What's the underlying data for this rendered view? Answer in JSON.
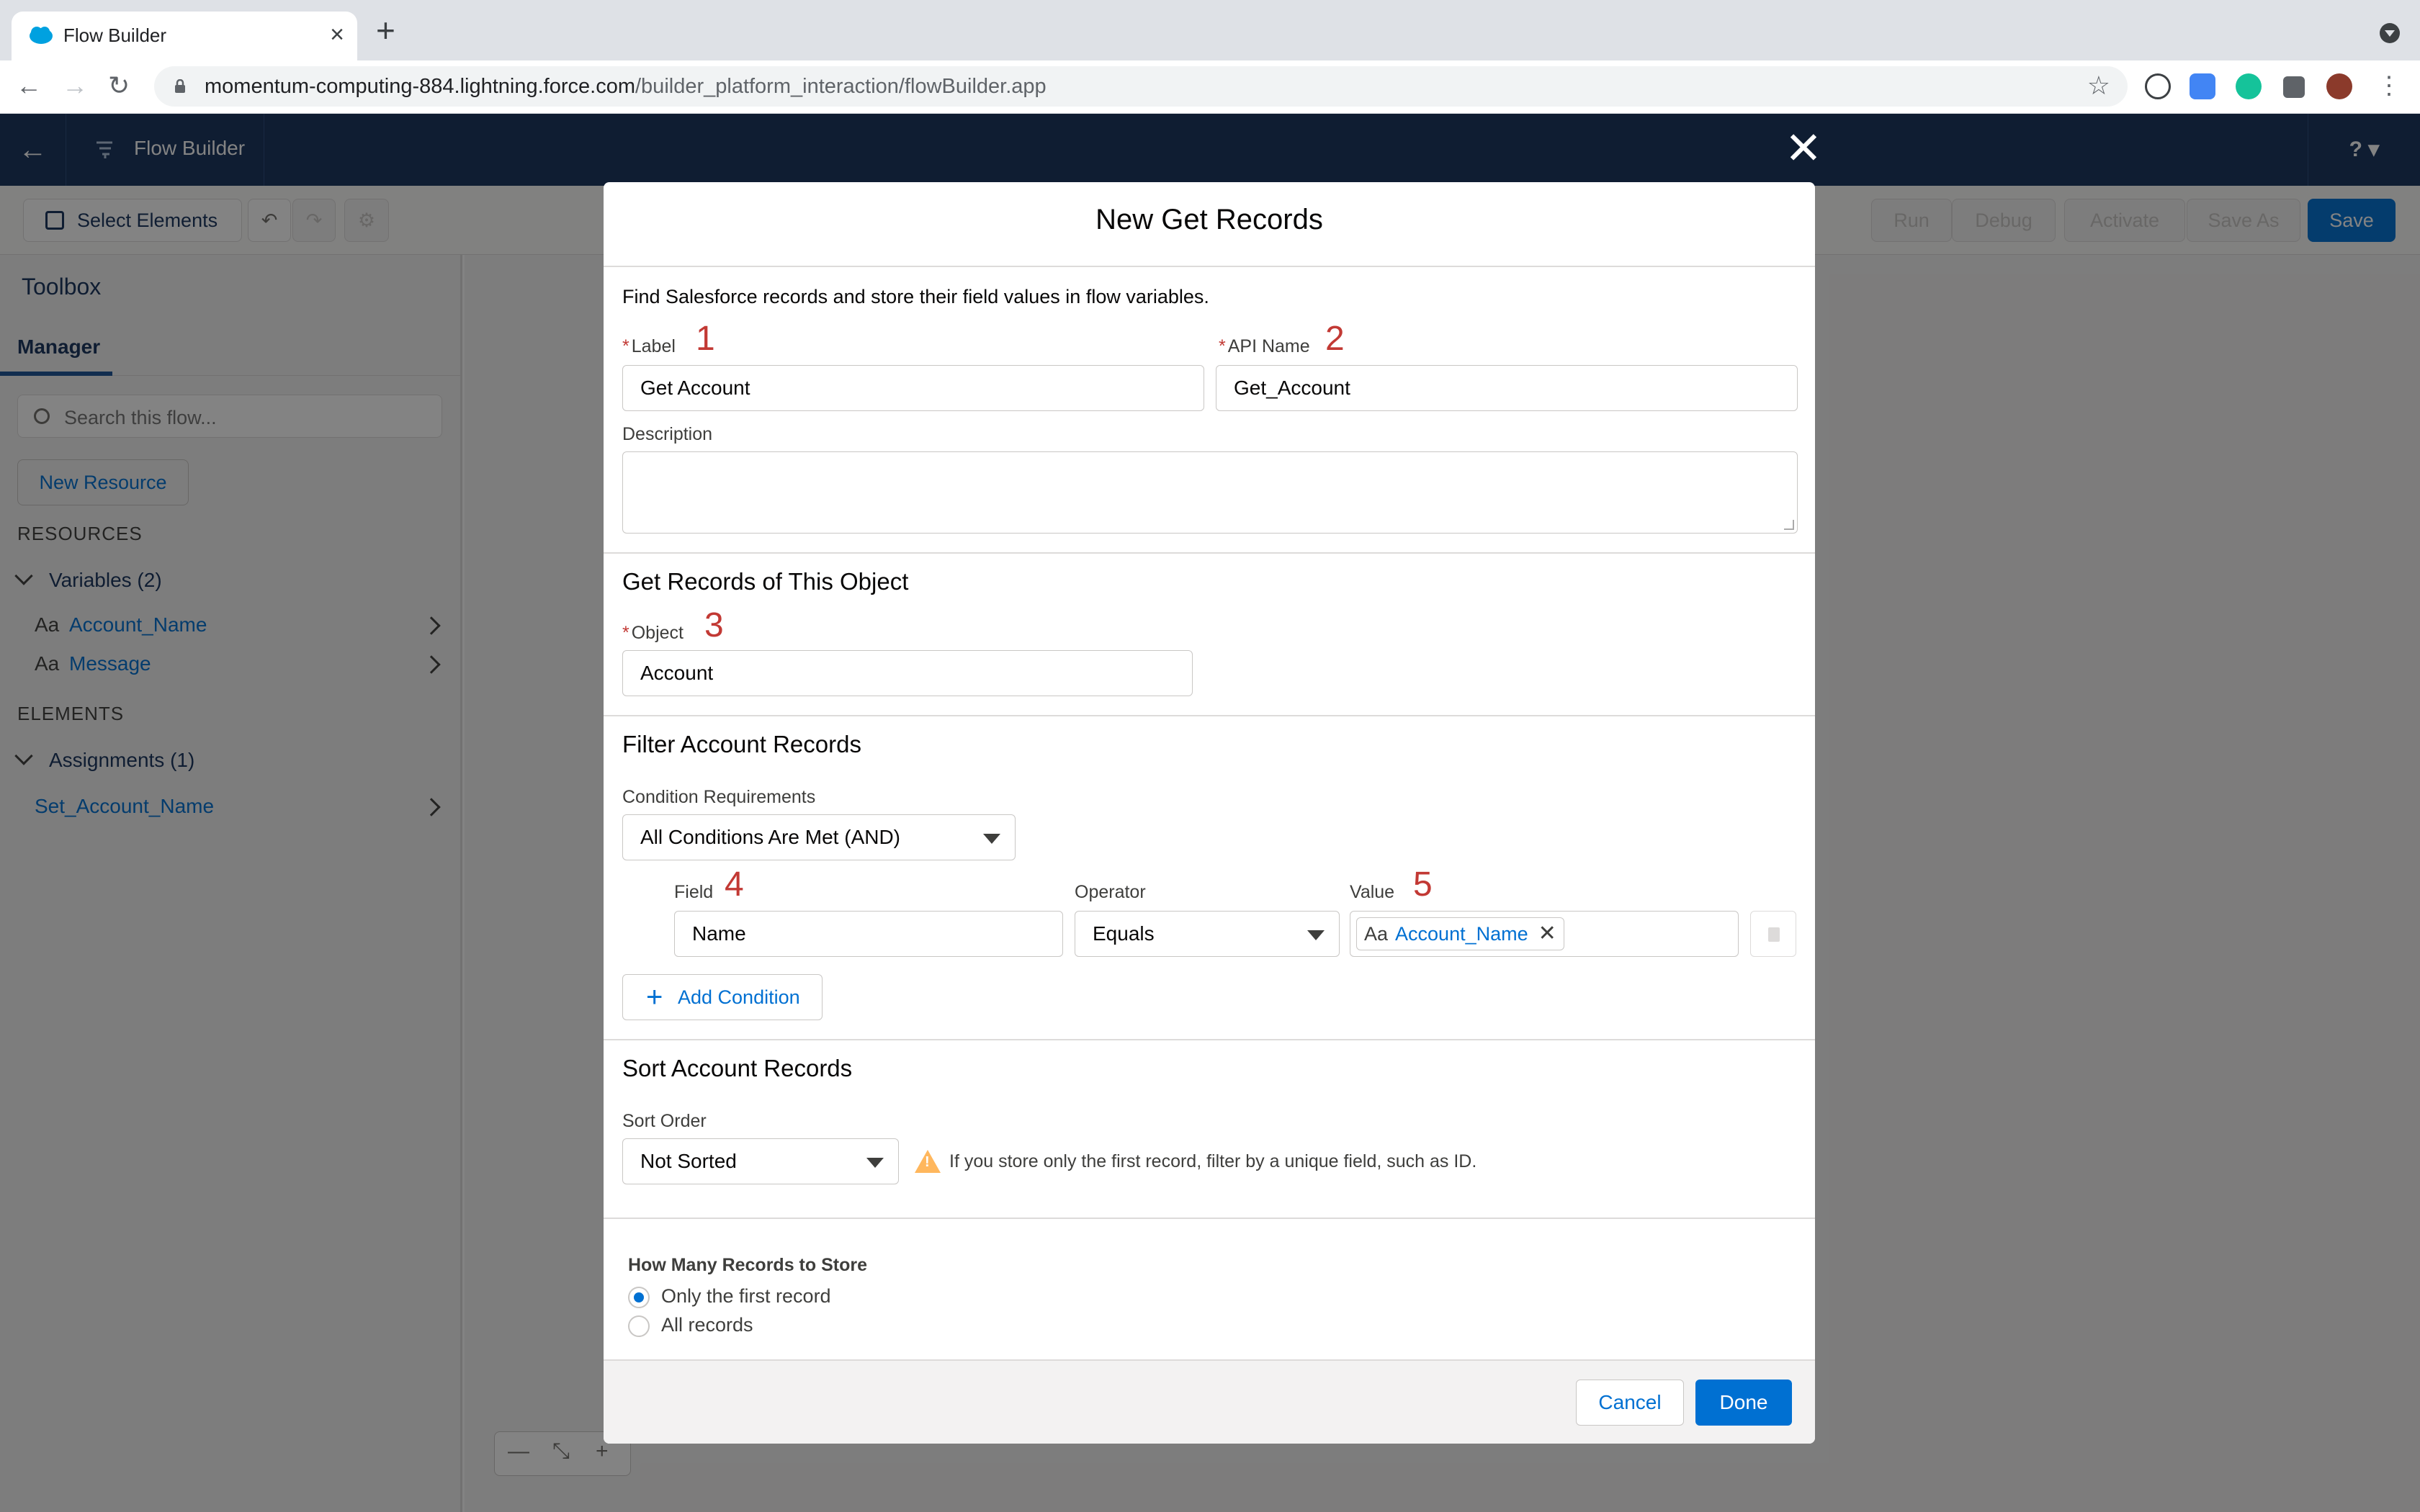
{
  "browser": {
    "tab_title": "Flow Builder",
    "url_host": "momentum-computing-884.lightning.force.com",
    "url_path": "/builder_platform_interaction/flowBuilder.app"
  },
  "app": {
    "title": "Flow Builder",
    "help": "?"
  },
  "toolbar": {
    "select_elements": "Select Elements",
    "run": "Run",
    "debug": "Debug",
    "activate": "Activate",
    "save_as": "Save As",
    "save": "Save"
  },
  "toolbox": {
    "title": "Toolbox",
    "tab_manager": "Manager",
    "search_placeholder": "Search this flow...",
    "new_resource": "New Resource",
    "resources_heading": "RESOURCES",
    "variables_group": "Variables (2)",
    "variables": [
      {
        "type": "Aa",
        "label": "Account_Name"
      },
      {
        "type": "Aa",
        "label": "Message"
      }
    ],
    "elements_heading": "ELEMENTS",
    "assignments_group": "Assignments (1)",
    "assignments": [
      {
        "label": "Set_Account_Name"
      }
    ]
  },
  "modal": {
    "title": "New Get Records",
    "intro": "Find Salesforce records and store their field values in flow variables.",
    "label_field": {
      "label": "Label",
      "value": "Get Account",
      "mark": "1"
    },
    "api_field": {
      "label": "API Name",
      "value": "Get_Account",
      "mark": "2"
    },
    "description_label": "Description",
    "object_section": {
      "title": "Get Records of This Object",
      "label": "Object",
      "value": "Account",
      "mark": "3"
    },
    "filter_section": {
      "title": "Filter Account Records",
      "req_label": "Condition Requirements",
      "req_value": "All Conditions Are Met (AND)",
      "field_label": "Field",
      "field_mark": "4",
      "field_value": "Name",
      "operator_label": "Operator",
      "operator_value": "Equals",
      "value_label": "Value",
      "value_mark": "5",
      "value_pill_type": "Aa",
      "value_pill": "Account_Name",
      "add_condition": "Add Condition"
    },
    "sort_section": {
      "title": "Sort Account Records",
      "label": "Sort Order",
      "value": "Not Sorted",
      "warning": "If you store only the first record, filter by a unique field, such as ID."
    },
    "store_section": {
      "title": "How Many Records to Store",
      "options": [
        {
          "label": "Only the first record",
          "checked": true
        },
        {
          "label": "All records",
          "checked": false
        }
      ]
    },
    "cancel": "Cancel",
    "done": "Done"
  },
  "colors": {
    "header_navy": "#16325c",
    "brand_blue": "#0070d2",
    "required_red": "#c23934",
    "warning_orange": "#ffb75d"
  }
}
